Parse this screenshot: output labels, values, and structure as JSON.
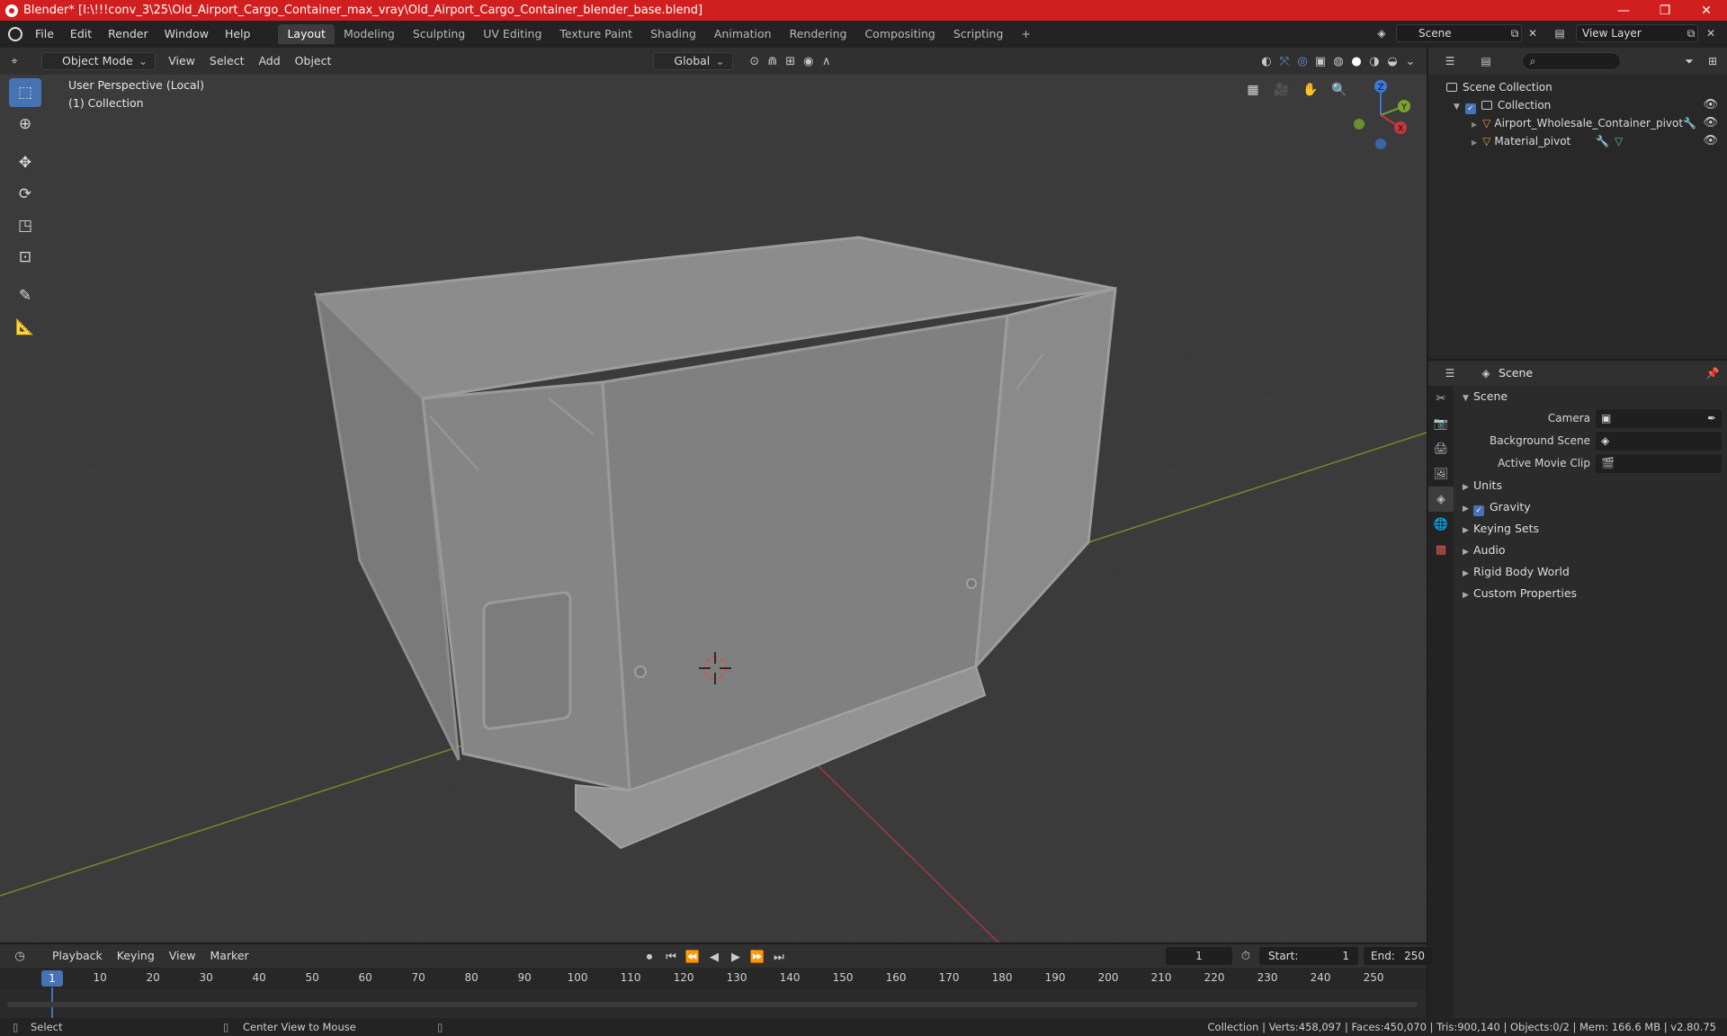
{
  "window": {
    "title": "Blender* [I:\\!!!conv_3\\25\\Old_Airport_Cargo_Container_max_vray\\Old_Airport_Cargo_Container_blender_base.blend]",
    "controls": [
      "—",
      "❐",
      "✕"
    ]
  },
  "menu": [
    "File",
    "Edit",
    "Render",
    "Window",
    "Help"
  ],
  "workspaces": [
    "Layout",
    "Modeling",
    "Sculpting",
    "UV Editing",
    "Texture Paint",
    "Shading",
    "Animation",
    "Rendering",
    "Compositing",
    "Scripting"
  ],
  "workspace_add": "+",
  "scene_name": "Scene",
  "view_layer": "View Layer",
  "viewport_header": {
    "mode": "Object Mode",
    "menus": [
      "View",
      "Select",
      "Add",
      "Object"
    ],
    "orientation": "Global"
  },
  "viewport": {
    "perspective": "User Perspective (Local)",
    "collection": "(1) Collection",
    "gizmo": {
      "x": "X",
      "y": "Y",
      "z": "Z"
    }
  },
  "outliner": {
    "search_placeholder": "",
    "root": "Scene Collection",
    "collection": "Collection",
    "items": [
      "Airport_Wholesale_Container_pivot",
      "Material_pivot"
    ]
  },
  "properties": {
    "header": "Scene",
    "section": "Scene",
    "rows": [
      {
        "label": "Camera",
        "value": ""
      },
      {
        "label": "Background Scene",
        "value": ""
      },
      {
        "label": "Active Movie Clip",
        "value": ""
      }
    ],
    "panels": [
      "Units",
      "Gravity",
      "Keying Sets",
      "Audio",
      "Rigid Body World",
      "Custom Properties"
    ]
  },
  "timeline": {
    "menus": [
      "Playback",
      "Keying",
      "View",
      "Marker"
    ],
    "current_frame": "1",
    "start_label": "Start:",
    "start": "1",
    "end_label": "End:",
    "end": "250",
    "ticks": [
      "1",
      "10",
      "20",
      "30",
      "40",
      "50",
      "60",
      "70",
      "80",
      "90",
      "100",
      "110",
      "120",
      "130",
      "140",
      "150",
      "160",
      "170",
      "180",
      "190",
      "200",
      "210",
      "220",
      "230",
      "240",
      "250"
    ]
  },
  "status": {
    "left": "Select",
    "middle": "Center View to Mouse",
    "right": "Collection | Verts:458,097 | Faces:450,070 | Tris:900,140 | Objects:0/2 | Mem: 166.6 MB | v2.80.75"
  },
  "colors": {
    "titlebar": "#d11e1e",
    "accent": "#4772b3",
    "x_axis": "#c8373f",
    "y_axis": "#7aa330",
    "z_axis": "#3b79d8"
  }
}
